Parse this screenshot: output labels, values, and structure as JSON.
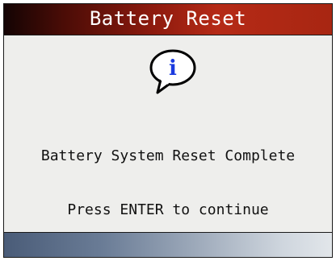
{
  "screen": {
    "title": "Battery Reset",
    "icon": "info-icon",
    "icon_glyph": "i",
    "message": "Battery System Reset Complete",
    "instruction": "Press ENTER to continue"
  },
  "colors": {
    "title_bar_dark": "#140404",
    "title_bar_light": "#b52a16",
    "body_background": "#eeeeec",
    "icon_glyph": "#1a3adf",
    "bottom_bar_dark": "#4a5c78",
    "bottom_bar_light": "#e2e6ea"
  }
}
